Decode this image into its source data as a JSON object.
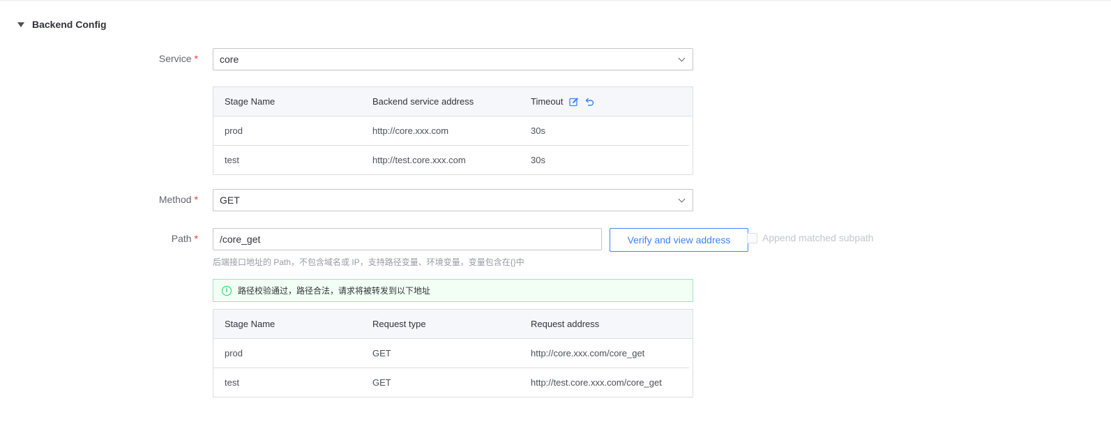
{
  "section": {
    "title": "Backend Config"
  },
  "service": {
    "label": "Service",
    "required_mark": "*",
    "value": "core"
  },
  "backend_table": {
    "headers": [
      "Stage Name",
      "Backend service address",
      "Timeout"
    ],
    "rows": [
      {
        "stage": "prod",
        "address": "http://core.xxx.com",
        "timeout": "30s"
      },
      {
        "stage": "test",
        "address": "http://test.core.xxx.com",
        "timeout": "30s"
      }
    ]
  },
  "method": {
    "label": "Method",
    "required_mark": "*",
    "value": "GET"
  },
  "path": {
    "label": "Path",
    "required_mark": "*",
    "value": "/core_get",
    "verify_button": "Verify and view address",
    "append_checkbox": "Append matched subpath",
    "hint": "后端接口地址的 Path，不包含域名或 IP，支持路径变量、环境变量，变量包含在{}中"
  },
  "alert": {
    "message": "路径校验通过，路径合法，请求将被转发到以下地址"
  },
  "request_table": {
    "headers": [
      "Stage Name",
      "Request type",
      "Request address"
    ],
    "rows": [
      {
        "stage": "prod",
        "type": "GET",
        "address": "http://core.xxx.com/core_get"
      },
      {
        "stage": "test",
        "type": "GET",
        "address": "http://test.core.xxx.com/core_get"
      }
    ]
  },
  "colors": {
    "accent": "#3a84ff",
    "required": "#ea3636",
    "success": "#2dcb56",
    "success_bg": "#f2fff4"
  }
}
